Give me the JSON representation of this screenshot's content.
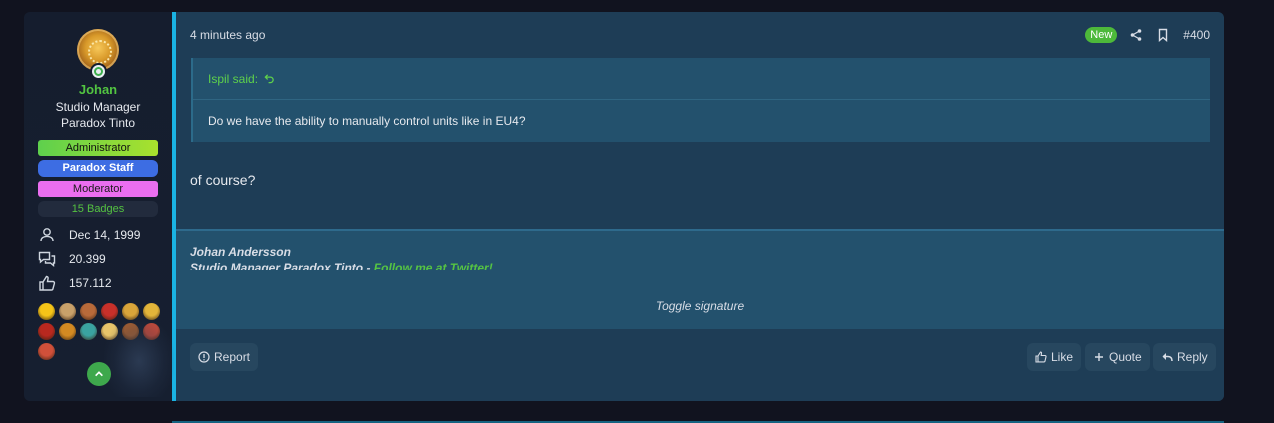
{
  "user": {
    "name": "Johan",
    "title_line1": "Studio Manager",
    "title_line2": "Paradox Tinto",
    "banners": [
      "Administrator",
      "Paradox Staff",
      "Moderator",
      "15 Badges"
    ],
    "joined": "Dec 14, 1999",
    "messages": "20.399",
    "reactions": "157.112",
    "trophy_colors": [
      "#f5c518",
      "#c9a16a",
      "#b86a3a",
      "#c8302a",
      "#d9a53a",
      "#e2b53a",
      "#b8281f",
      "#d38a22",
      "#3aa3a0",
      "#e6c46a",
      "#a86030",
      "#c84b3a",
      "#d0503a"
    ]
  },
  "post": {
    "time": "4 minutes ago",
    "new_label": "New",
    "number": "#400",
    "quote_author": "Ispil said:",
    "quote_text": "Do we have the ability to manually control units like in EU4?",
    "message": "of course?"
  },
  "signature": {
    "name": "Johan Andersson",
    "line2_text": "Studio Manager Paradox Tinto - ",
    "line2_link": "Follow me at Twitter!",
    "toggle": "Toggle signature"
  },
  "actions": {
    "report": "Report",
    "like": "Like",
    "quote": "Quote",
    "reply": "Reply"
  },
  "colors": {
    "accent": "#1ab3e3",
    "username": "#52c441",
    "new_badge": "#4db93a"
  }
}
